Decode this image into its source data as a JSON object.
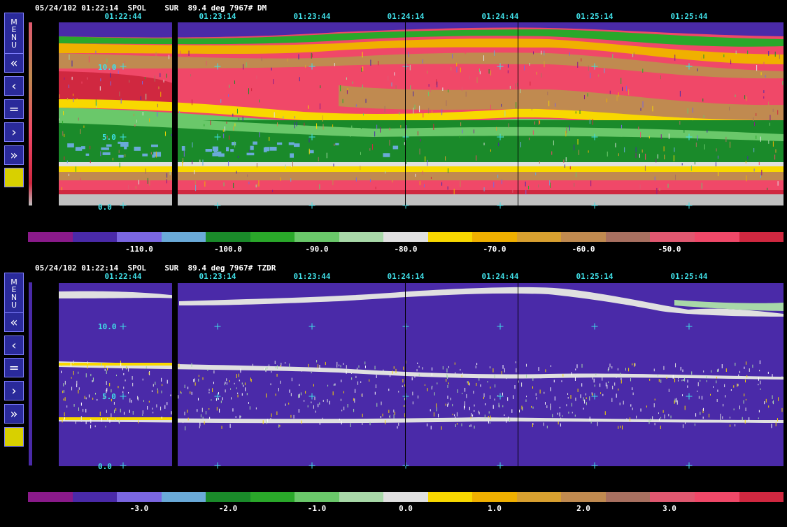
{
  "panels": [
    {
      "header": "05/24/102 01:22:14  SPOL    SUR  89.4 deg 7967# DM",
      "field": "DM",
      "times": [
        "01:22:44",
        "01:23:14",
        "01:23:44",
        "01:24:14",
        "01:24:44",
        "01:25:14",
        "01:25:44"
      ],
      "heights": [
        "10.0",
        "5.0",
        "0.0"
      ],
      "colorbar_labels": [
        "-110.0",
        "-100.0",
        "-90.0",
        "-80.0",
        "-70.0",
        "-60.0",
        "-50.0"
      ]
    },
    {
      "header": "05/24/102 01:22:14  SPOL    SUR  89.4 deg 7967# TZDR",
      "field": "TZDR",
      "times": [
        "01:22:44",
        "01:23:14",
        "01:23:44",
        "01:24:14",
        "01:24:44",
        "01:25:14",
        "01:25:44"
      ],
      "heights": [
        "10.0",
        "5.0",
        "0.0"
      ],
      "colorbar_labels": [
        "-3.0",
        "-2.0",
        "-1.0",
        "0.0",
        "1.0",
        "2.0",
        "3.0"
      ]
    }
  ],
  "toolbar": {
    "menu_letters": [
      "M",
      "E",
      "N",
      "U"
    ],
    "fast_back": "«",
    "back": "‹",
    "equal": "=",
    "forward": "›",
    "fast_forward": "»"
  },
  "colors": {
    "cyan": "#40e0e8",
    "background": "#000000",
    "colormap": [
      "#8a1a8a",
      "#4a2aa8",
      "#7a66e0",
      "#6aaad8",
      "#1a8a2a",
      "#2aa82a",
      "#6ac86a",
      "#a8d8a8",
      "#e0e0e0",
      "#f8d800",
      "#f0b000",
      "#d8a030",
      "#c08a50",
      "#a87060",
      "#e05870",
      "#f04868",
      "#d02840"
    ]
  }
}
